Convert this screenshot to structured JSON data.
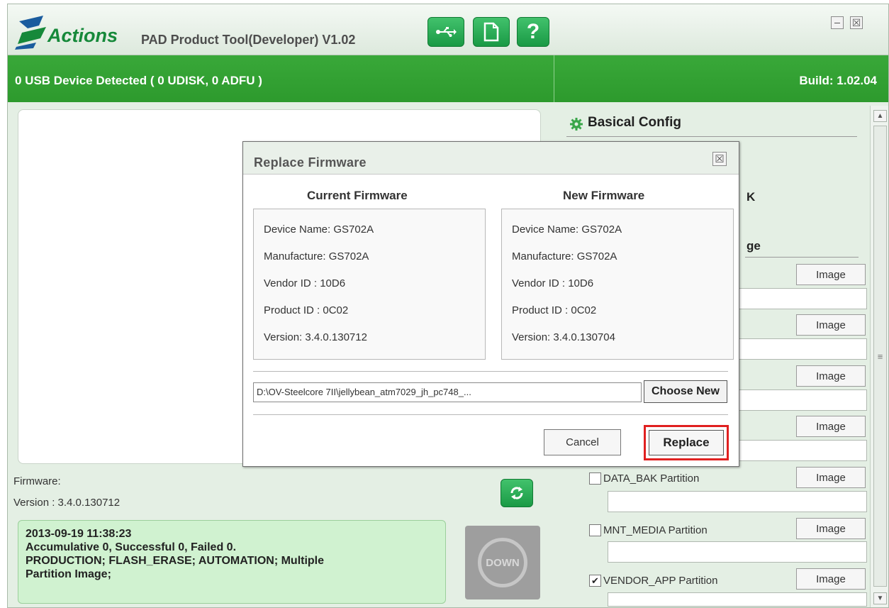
{
  "app": {
    "logo_text": "Actions",
    "title": "PAD Product Tool(Developer) V1.02",
    "toolbar_help_label": "?",
    "close_glyph": "☒"
  },
  "status": {
    "devices": "0 USB Device Detected ( 0 UDISK, 0 ADFU )",
    "build": "Build: 1.02.04"
  },
  "left": {
    "firmware_label": "Firmware:",
    "firmware_version": "Version : 3.4.0.130712",
    "info_lines": [
      "2013-09-19 11:38:23",
      "Accumulative 0, Successful 0, Failed 0.",
      "PRODUCTION; FLASH_ERASE; AUTOMATION; Multiple",
      "Partition Image;"
    ],
    "down_label": "DOWN"
  },
  "right": {
    "config_header": "Basical Config",
    "partial_1": "K",
    "partial_2": "ge",
    "image_label": "Image",
    "partitions": [
      {
        "label": "DATA_BAK Partition",
        "checked": false
      },
      {
        "label": "MNT_MEDIA Partition",
        "checked": false
      },
      {
        "label": "VENDOR_APP Partition",
        "checked": true
      }
    ],
    "check_glyph": "✔",
    "scroll_up": "▲",
    "scroll_down": "▼",
    "scroll_grip": "≡"
  },
  "dialog": {
    "title": "Replace Firmware",
    "close_glyph": "☒",
    "current_header": "Current Firmware",
    "new_header": "New Firmware",
    "current": {
      "device_name": "Device Name: GS702A",
      "manufacture": "Manufacture: GS702A",
      "vendor_id": "Vendor ID  : 10D6",
      "product_id": "Product ID : 0C02",
      "version": "Version: 3.4.0.130712"
    },
    "new": {
      "device_name": "Device Name: GS702A",
      "manufacture": "Manufacture: GS702A",
      "vendor_id": "Vendor ID  : 10D6",
      "product_id": "Product ID : 0C02",
      "version": "Version: 3.4.0.130704"
    },
    "path_value": "D:\\OV-Steelcore 7II\\jellybean_atm7029_jh_pc748_...",
    "choose_new_label": "Choose New",
    "cancel_label": "Cancel",
    "replace_label": "Replace"
  },
  "colors": {
    "accent_green": "#1a9a45",
    "status_bar": "#2d9a2d",
    "highlight_red": "#e02020"
  }
}
